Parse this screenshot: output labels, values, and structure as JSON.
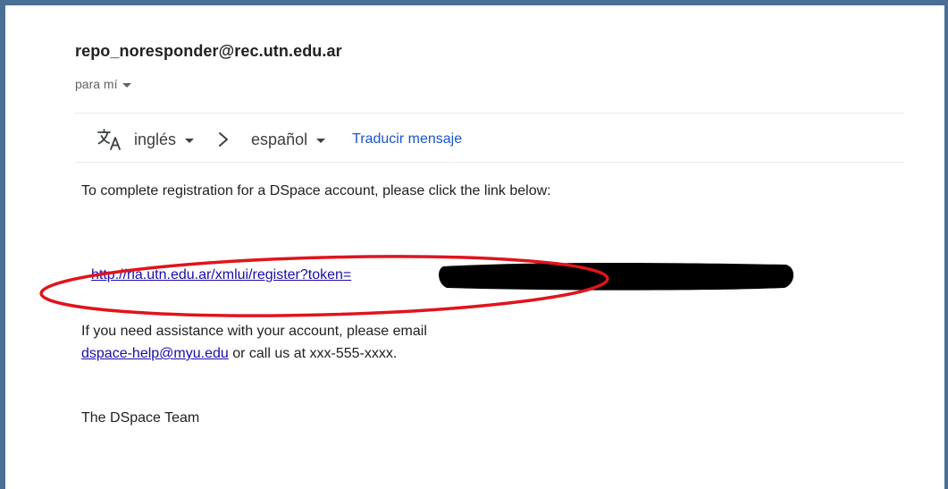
{
  "email": {
    "sender": "repo_noresponder@rec.utn.edu.ar",
    "recipient_label": "para mí"
  },
  "translate_bar": {
    "icon": "translate-icon",
    "source_language": "inglés",
    "target_language": "español",
    "translate_link": "Traducir mensaje"
  },
  "body": {
    "intro": "To complete registration for a DSpace account, please click the link below:",
    "registration_link": "http://ria.utn.edu.ar/xmlui/register?token=",
    "assist_prefix": "If you need assistance with your account, please email",
    "help_email": "dspace-help@myu.edu",
    "assist_suffix": "or call us at xxx-555-xxxx.",
    "signature": "The DSpace Team"
  },
  "annotation": {
    "highlight_color": "#e0141c",
    "redaction_color": "#000000"
  },
  "colors": {
    "frame": "#4a6f96",
    "link": "#1a0dab",
    "translate_link": "#1a55c9"
  }
}
